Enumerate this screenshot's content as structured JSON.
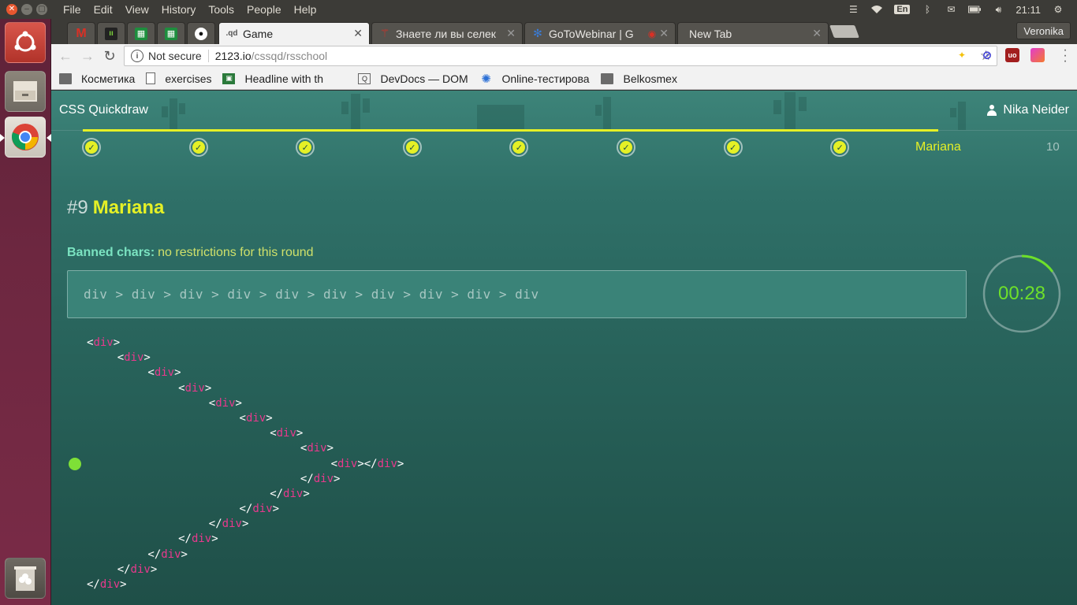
{
  "system_bar": {
    "menu": [
      "File",
      "Edit",
      "View",
      "History",
      "Tools",
      "People",
      "Help"
    ],
    "keyboard_layout": "En",
    "clock": "21:11"
  },
  "tabs": {
    "pinned_icons": [
      "gmail-icon",
      "ib-icon",
      "sheets-icon",
      "sheets-icon",
      "github-icon"
    ],
    "items": [
      {
        "title": "Game",
        "favicon": ".qd",
        "active": true
      },
      {
        "title": "Знаете ли вы селек",
        "favicon": "radio-icon"
      },
      {
        "title": "GoToWebinar | G",
        "favicon": "gtw-icon"
      },
      {
        "title": "New Tab",
        "favicon": ""
      }
    ],
    "profile_name": "Veronika"
  },
  "toolbar": {
    "security_label": "Not secure",
    "url_host": "2123.io",
    "url_path": "/cssqd/rsschool"
  },
  "bookmarks": [
    {
      "label": "Косметика",
      "icon": "folder"
    },
    {
      "label": "exercises",
      "icon": "doc"
    },
    {
      "label": "Headline with th",
      "icon": "green"
    },
    {
      "label": "DevDocs — DOM",
      "icon": "devdocs"
    },
    {
      "label": "Online-тестирова",
      "icon": "gear"
    },
    {
      "label": "Belkosmex",
      "icon": "folder"
    }
  ],
  "page": {
    "app_title": "CSS Quickdraw",
    "user_name": "Nika Neider",
    "progress": {
      "completed_steps": 8,
      "current_label": "Mariana",
      "last_label": "10"
    },
    "round_number": "#9",
    "round_name": "Mariana",
    "banned_label": "Banned chars:",
    "banned_value": "no restrictions for this round",
    "selector": "div > div > div > div > div > div > div > div > div > div",
    "timer": "00:28",
    "timer_fraction": 0.15,
    "code_lines": [
      {
        "indent": 0,
        "open": "<",
        "tag": "div",
        "close": ">"
      },
      {
        "indent": 1,
        "open": "<",
        "tag": "div",
        "close": ">"
      },
      {
        "indent": 2,
        "open": "<",
        "tag": "div",
        "close": ">"
      },
      {
        "indent": 3,
        "open": "<",
        "tag": "div",
        "close": ">"
      },
      {
        "indent": 4,
        "open": "<",
        "tag": "div",
        "close": ">"
      },
      {
        "indent": 5,
        "open": "<",
        "tag": "div",
        "close": ">"
      },
      {
        "indent": 6,
        "open": "<",
        "tag": "div",
        "close": ">"
      },
      {
        "indent": 7,
        "open": "<",
        "tag": "div",
        "close": ">"
      },
      {
        "indent": 8,
        "open": "<",
        "tag": "div",
        "close": "></",
        "tag2": "div",
        "close2": ">"
      },
      {
        "indent": 7,
        "open": "</",
        "tag": "div",
        "close": ">"
      },
      {
        "indent": 6,
        "open": "</",
        "tag": "div",
        "close": ">"
      },
      {
        "indent": 5,
        "open": "</",
        "tag": "div",
        "close": ">"
      },
      {
        "indent": 4,
        "open": "</",
        "tag": "div",
        "close": ">"
      },
      {
        "indent": 3,
        "open": "</",
        "tag": "div",
        "close": ">"
      },
      {
        "indent": 2,
        "open": "</",
        "tag": "div",
        "close": ">"
      },
      {
        "indent": 1,
        "open": "</",
        "tag": "div",
        "close": ">"
      },
      {
        "indent": 0,
        "open": "</",
        "tag": "div",
        "close": ">"
      }
    ]
  },
  "colors": {
    "accent_yellow": "#e5f026",
    "timer_green": "#6ee02a",
    "tag_pink": "#e8398d",
    "page_teal": "#2f7068"
  }
}
